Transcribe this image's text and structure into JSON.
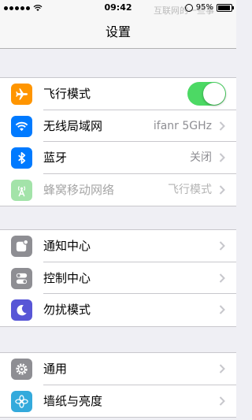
{
  "status": {
    "time": "09:42",
    "watermark": "互联网的一些事",
    "battery": "95%",
    "battery_level": 0.95,
    "signal_bars": 5
  },
  "nav": {
    "title": "设置"
  },
  "groups": [
    {
      "items": [
        {
          "label": "飞行模式",
          "icon": "airplane-icon",
          "color": "#ff9500",
          "control": "toggle",
          "toggle_on": true
        },
        {
          "label": "无线局域网",
          "icon": "wifi-icon",
          "color": "#007aff",
          "value": "ifanr 5GHz"
        },
        {
          "label": "蓝牙",
          "icon": "bluetooth-icon",
          "color": "#007aff",
          "value": "关闭"
        },
        {
          "label": "蜂窝移动网络",
          "icon": "cellular-icon",
          "color": "#a3e3a9",
          "value": "飞行模式",
          "dimmed": true
        }
      ]
    },
    {
      "items": [
        {
          "label": "通知中心",
          "icon": "notification-center-icon",
          "color": "#8e8e93"
        },
        {
          "label": "控制中心",
          "icon": "control-center-icon",
          "color": "#8e8e93"
        },
        {
          "label": "勿扰模式",
          "icon": "moon-icon",
          "color": "#5856d6"
        }
      ]
    },
    {
      "items": [
        {
          "label": "通用",
          "icon": "gear-icon",
          "color": "#8e8e93"
        },
        {
          "label": "墙纸与亮度",
          "icon": "wallpaper-icon",
          "color": "#34aadc"
        }
      ]
    }
  ]
}
